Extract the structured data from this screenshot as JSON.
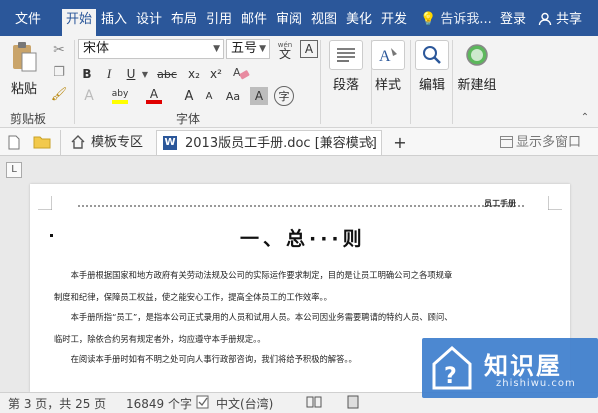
{
  "menubar": {
    "tabs": [
      "文件",
      "开始",
      "插入",
      "设计",
      "布局",
      "引用",
      "邮件",
      "审阅",
      "视图",
      "美化",
      "开发"
    ],
    "active_tab": "开始",
    "tell_me": "告诉我...",
    "login": "登录",
    "share": "共享"
  },
  "ribbon": {
    "clipboard": {
      "paste": "粘贴",
      "group_label": "剪贴板"
    },
    "font": {
      "font_name": "宋体",
      "font_size": "五号",
      "wen_top": "wén",
      "wen_char": "文",
      "boxed_a": "A",
      "bold": "B",
      "italic": "I",
      "underline": "U",
      "strikethrough": "abc",
      "subscript": "x₂",
      "superscript": "x²",
      "text_effects": "A",
      "highlight": "aby",
      "font_color": "A",
      "grow": "A",
      "shrink": "A",
      "change_case": "Aa",
      "char_shading": "A",
      "enclose": "字",
      "group_label": "字体"
    },
    "paragraph": "段落",
    "styles": "样式",
    "editing": "编辑",
    "new_group": "新建组"
  },
  "doctabs": {
    "template_zone": "模板专区",
    "doc_title": "2013版员工手册.doc [兼容模式]",
    "doc_app": "W",
    "close": "✕",
    "add": "+",
    "multi_window": "显示多窗口"
  },
  "ruler": {
    "tab_marker": "L"
  },
  "document": {
    "header_text": "员工手册",
    "title": "一、总···则",
    "paragraphs": [
      "　　本手册根据国家和地方政府有关劳动法规及公司的实际运作要求制定，目的是让员工明确公司之各项规章",
      "制度和纪律，保障员工权益，使之能安心工作，提高全体员工的工作效率。。",
      "　　本手册所指“员工”，是指本公司正式录用的人员和试用人员。本公司因业务需要聘请的特约人员、顾问、",
      "临时工，除依合约另有规定者外，均应遵守本手册规定。。",
      "　　在阅读本手册时如有不明之处可向人事行政部咨询，我们将给予积极的解答。。"
    ]
  },
  "statusbar": {
    "page": "第 3 页，共 25 页",
    "words": "16849 个字",
    "language": "中文(台湾)"
  },
  "watermark": {
    "name": "知识屋",
    "domain": "zhishiwu.com"
  }
}
